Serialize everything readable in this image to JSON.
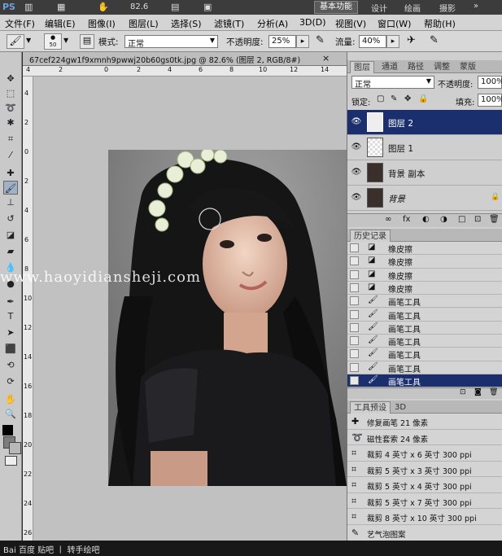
{
  "titlebar": {
    "logo": "PS",
    "zoom": "82.6",
    "workspaces": [
      "基本功能",
      "设计",
      "绘画",
      "摄影"
    ],
    "more": "»"
  },
  "menubar": {
    "items": [
      "文件(F)",
      "编辑(E)",
      "图像(I)",
      "图层(L)",
      "选择(S)",
      "滤镜(T)",
      "分析(A)",
      "3D(D)",
      "视图(V)",
      "窗口(W)",
      "帮助(H)"
    ]
  },
  "options": {
    "brush_size": "50",
    "mode_label": "模式:",
    "mode_value": "正常",
    "opacity_label": "不透明度:",
    "opacity_value": "25%",
    "flow_label": "流量:",
    "flow_value": "40%"
  },
  "document": {
    "tab_title": "67cef224gw1f9xmnh9pwwj20b60gs0tk.jpg @ 82.6% (图层 2, RGB/8#)",
    "close": "×",
    "ruler_top": [
      "4",
      "2",
      "0",
      "2",
      "4",
      "6",
      "8",
      "10",
      "12",
      "14"
    ],
    "ruler_left": [
      "4",
      "2",
      "0",
      "2",
      "4",
      "6",
      "8",
      "10",
      "12",
      "14",
      "16",
      "18",
      "20",
      "22",
      "24",
      "26"
    ]
  },
  "layers_panel": {
    "tabs": [
      "图层",
      "通道",
      "路径",
      "调整",
      "蒙版"
    ],
    "blend_mode": "正常",
    "opacity_label": "不透明度:",
    "opacity_value": "100%",
    "lock_label": "锁定:",
    "fill_label": "填充:",
    "fill_value": "100%",
    "layers": [
      {
        "name": "图层 2",
        "selected": true
      },
      {
        "name": "图层 1",
        "selected": false
      },
      {
        "name": "背景 副本",
        "selected": false
      },
      {
        "name": "背景",
        "selected": false,
        "locked": true
      }
    ],
    "bottom_icons": [
      "∞",
      "fx",
      "◐",
      "◑",
      "□",
      "⊡",
      "🗑"
    ]
  },
  "history_panel": {
    "title": "历史记录",
    "items": [
      {
        "label": "橡皮擦",
        "selected": false
      },
      {
        "label": "橡皮擦",
        "selected": false
      },
      {
        "label": "橡皮擦",
        "selected": false
      },
      {
        "label": "橡皮擦",
        "selected": false
      },
      {
        "label": "画笔工具",
        "selected": false
      },
      {
        "label": "画笔工具",
        "selected": false
      },
      {
        "label": "画笔工具",
        "selected": false
      },
      {
        "label": "画笔工具",
        "selected": false
      },
      {
        "label": "画笔工具",
        "selected": false
      },
      {
        "label": "画笔工具",
        "selected": false
      },
      {
        "label": "画笔工具",
        "selected": true
      }
    ]
  },
  "presets_panel": {
    "tabs": [
      "工具预设",
      "3D"
    ],
    "items": [
      "修复画笔 21 像素",
      "磁性套索 24 像素",
      "裁剪 4 英寸 x 6 英寸 300 ppi",
      "裁剪 5 英寸 x 3 英寸 300 ppi",
      "裁剪 5 英寸 x 4 英寸 300 ppi",
      "裁剪 5 英寸 x 7 英寸 300 ppi",
      "裁剪 8 英寸 x 10 英寸 300 ppi",
      "艺气泡图案"
    ]
  },
  "status": {
    "text": "Bai 百度 贴吧 丨 转手绘吧"
  },
  "watermark": "www.haoyidiansheji.com"
}
